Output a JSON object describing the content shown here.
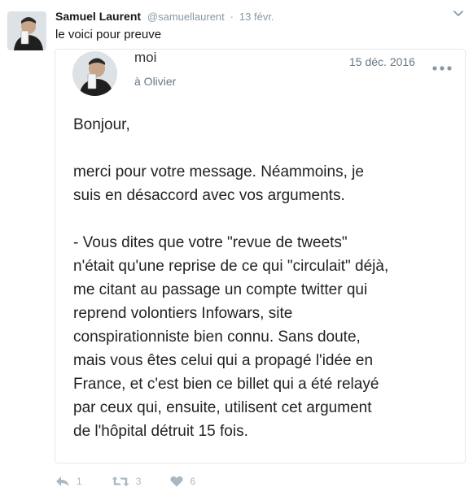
{
  "tweet": {
    "author_name": "Samuel Laurent",
    "handle": "@samuellaurent",
    "separator": "·",
    "date": "13 févr.",
    "text": "le voici pour preuve"
  },
  "screenshot": {
    "sender": "moi",
    "recipient": "à Olivier",
    "date": "15 déc. 2016",
    "body": {
      "greeting": "Bonjour,",
      "line1": "merci pour votre message. Néammoins, je",
      "line2": "suis en désaccord avec vos arguments.",
      "lines": [
        "- Vous dites que votre \"revue de tweets\"",
        "n'était qu'une reprise de ce qui \"circulait\" déjà,",
        "me citant au passage un compte twitter qui",
        "reprend volontiers Infowars, site",
        "conspirationniste bien connu. Sans doute,",
        "mais vous êtes celui qui a propagé l'idée en",
        "France, et c'est bien ce billet qui a été relayé",
        "par ceux qui, ensuite, utilisent cet argument",
        "de l'hôpital détruit 15 fois."
      ]
    }
  },
  "actions": {
    "reply_count": "1",
    "retweet_count": "3",
    "like_count": "6"
  },
  "icons": {
    "caret": "chevron-down-icon",
    "more": "more-dots-icon",
    "reply": "reply-icon",
    "retweet": "retweet-icon",
    "like": "heart-icon"
  },
  "colors": {
    "muted": "#8899a6",
    "action_icon": "#aab8c2",
    "card_border": "#e1e8ed"
  }
}
